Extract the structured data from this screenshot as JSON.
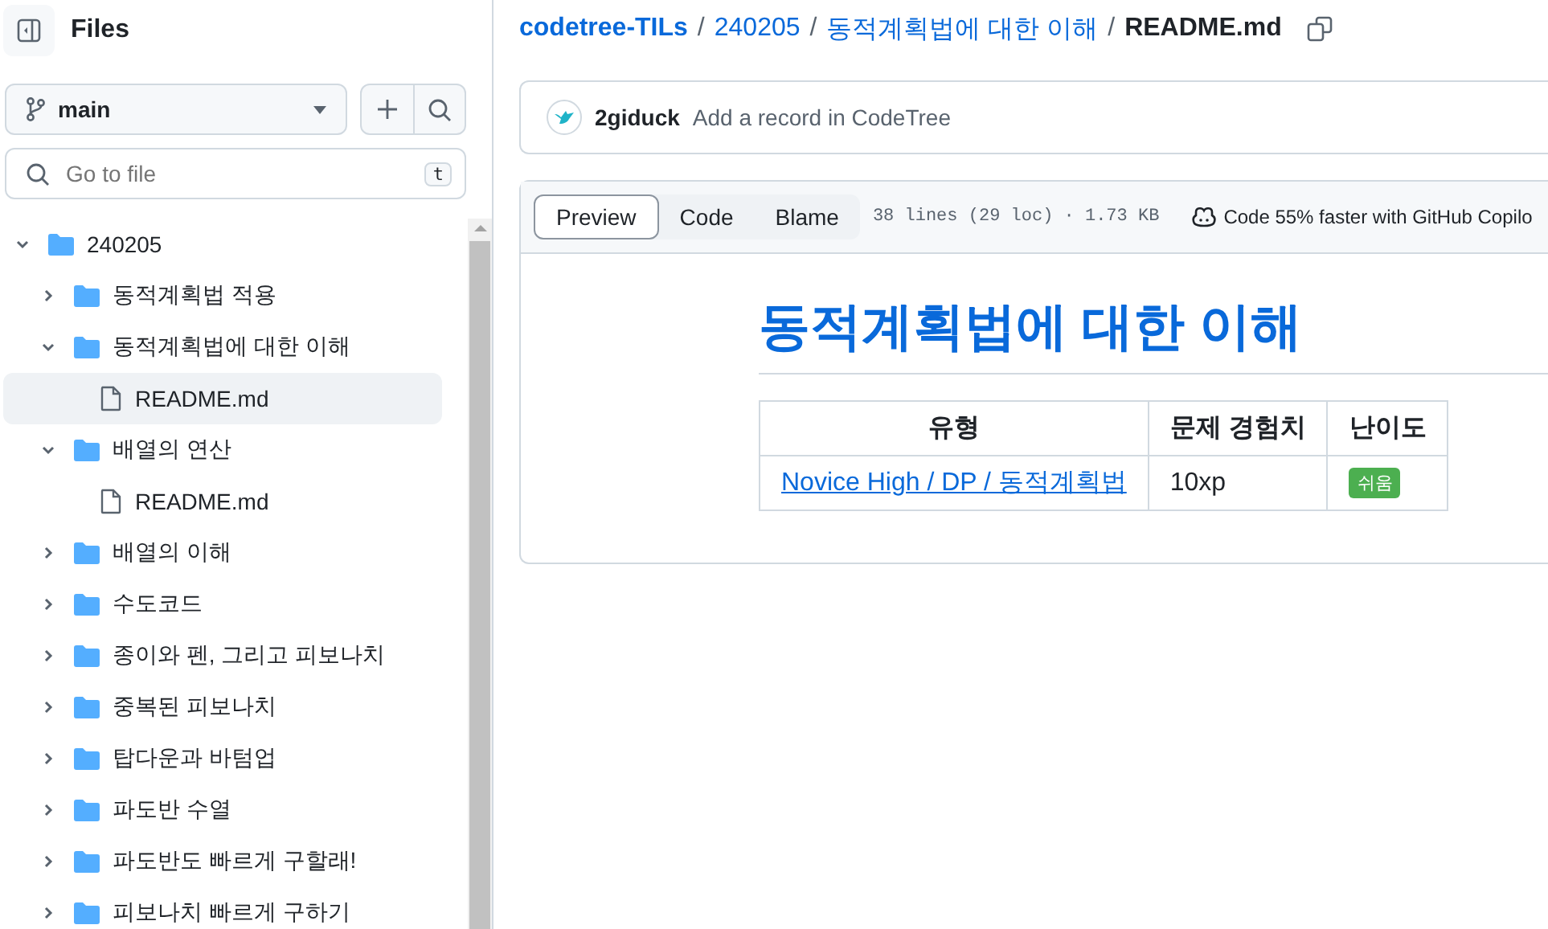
{
  "sidebar": {
    "title": "Files",
    "branch": "main",
    "search": {
      "placeholder": "Go to file",
      "shortcut": "t"
    },
    "tree": [
      {
        "kind": "folder",
        "label": "240205",
        "expanded": true,
        "children": [
          {
            "kind": "folder",
            "label": "동적계획법 적용",
            "expanded": false
          },
          {
            "kind": "folder",
            "label": "동적계획법에 대한 이해",
            "expanded": true,
            "children": [
              {
                "kind": "file",
                "label": "README.md",
                "selected": true
              }
            ]
          },
          {
            "kind": "folder",
            "label": "배열의 연산",
            "expanded": true,
            "children": [
              {
                "kind": "file",
                "label": "README.md",
                "selected": false
              }
            ]
          },
          {
            "kind": "folder",
            "label": "배열의 이해",
            "expanded": false
          },
          {
            "kind": "folder",
            "label": "수도코드",
            "expanded": false
          },
          {
            "kind": "folder",
            "label": "종이와 펜, 그리고 피보나치",
            "expanded": false
          },
          {
            "kind": "folder",
            "label": "중복된 피보나치",
            "expanded": false
          },
          {
            "kind": "folder",
            "label": "탑다운과 바텀업",
            "expanded": false
          },
          {
            "kind": "folder",
            "label": "파도반 수열",
            "expanded": false
          },
          {
            "kind": "folder",
            "label": "파도반도 빠르게 구할래!",
            "expanded": false
          },
          {
            "kind": "folder",
            "label": "피보나치 빠르게 구하기",
            "expanded": false
          }
        ]
      }
    ]
  },
  "breadcrumb_separator": "/",
  "breadcrumb": [
    {
      "label": "codetree-TILs",
      "kind": "repo"
    },
    {
      "label": "240205",
      "kind": "link"
    },
    {
      "label": "동적계획법에 대한 이해",
      "kind": "link"
    },
    {
      "label": "README.md",
      "kind": "current"
    }
  ],
  "commit": {
    "author": "2giduck",
    "message": "Add a record in CodeTree"
  },
  "file_tabs": [
    {
      "label": "Preview",
      "selected": true
    },
    {
      "label": "Code",
      "selected": false
    },
    {
      "label": "Blame",
      "selected": false
    }
  ],
  "file_info": "38 lines (29 loc) · 1.73 KB",
  "copilot": "Code 55% faster with GitHub Copilo",
  "readme": {
    "heading": "동적계획법에 대한 이해",
    "table": {
      "columns": [
        "유형",
        "문제 경험치",
        "난이도"
      ],
      "rows": [
        {
          "type": "Novice High / DP / 동적계획법",
          "xp": "10xp",
          "difficulty": "쉬움",
          "color": "#4caf50"
        }
      ]
    }
  }
}
